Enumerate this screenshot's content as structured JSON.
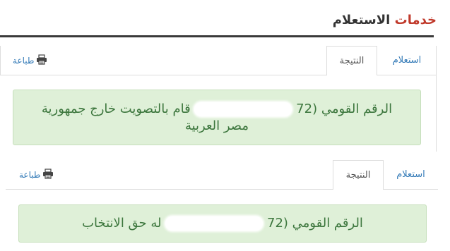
{
  "header": {
    "title_part1": "خدمات",
    "title_part2": "الاستعلام"
  },
  "panels": [
    {
      "tabs": {
        "inquiry": "استعلام",
        "result": "النتيجة"
      },
      "print_label": "طباعة",
      "message": {
        "before": "الرقم القومي (72",
        "after": "قام بالتصويت خارج جمهورية مصر العربية"
      }
    },
    {
      "tabs": {
        "inquiry": "استعلام",
        "result": "النتيجة"
      },
      "print_label": "طباعة",
      "message": {
        "before": "الرقم القومي (72",
        "after": "له حق الانتخاب"
      }
    }
  ],
  "colors": {
    "title_accent": "#c0392b",
    "link": "#337ab7",
    "success_bg": "#dff0d8",
    "success_text": "#3c763d"
  },
  "icons": {
    "print": "printer-icon"
  }
}
